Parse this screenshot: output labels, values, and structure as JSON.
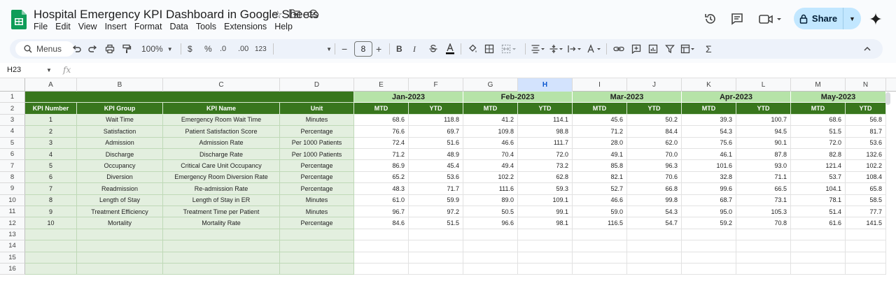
{
  "app": {
    "doc_title": "Hospital Emergency KPI Dashboard in Google Sheets",
    "menu": [
      "File",
      "Edit",
      "View",
      "Insert",
      "Format",
      "Data",
      "Tools",
      "Extensions",
      "Help"
    ],
    "share_label": "Share"
  },
  "toolbar": {
    "menus_label": "Menus",
    "zoom": "100%",
    "currency": "$",
    "percent": "%",
    "dec_decrease": ".0",
    "dec_increase": ".00",
    "number_format": "123",
    "font_size": "8",
    "minus": "−",
    "plus": "+",
    "bold": "B",
    "italic": "I"
  },
  "formula_bar": {
    "name_box": "H23",
    "fx": "fx"
  },
  "columns": [
    "A",
    "B",
    "C",
    "D",
    "E",
    "F",
    "G",
    "H",
    "I",
    "J",
    "K",
    "L",
    "M",
    "N"
  ],
  "selected_column": "H",
  "row_numbers": [
    "1",
    "2",
    "3",
    "4",
    "5",
    "6",
    "7",
    "8",
    "9",
    "10",
    "11",
    "12",
    "13",
    "14",
    "15",
    "16"
  ],
  "sheet": {
    "headers": [
      "KPI Number",
      "KPI Group",
      "KPI Name",
      "Unit"
    ],
    "months": [
      "Jan-2023",
      "Feb-2023",
      "Mar-2023",
      "Apr-2023",
      "May-2023"
    ],
    "mtd_label": "MTD",
    "ytd_label": "YTD",
    "rows": [
      {
        "num": "1",
        "group": "Wait Time",
        "name": "Emergency Room Wait Time",
        "unit": "Minutes",
        "values": [
          "68.6",
          "118.8",
          "41.2",
          "114.1",
          "45.6",
          "50.2",
          "39.3",
          "100.7",
          "68.6",
          "56.8"
        ]
      },
      {
        "num": "2",
        "group": "Satisfaction",
        "name": "Patient Satisfaction Score",
        "unit": "Percentage",
        "values": [
          "76.6",
          "69.7",
          "109.8",
          "98.8",
          "71.2",
          "84.4",
          "54.3",
          "94.5",
          "51.5",
          "81.7"
        ]
      },
      {
        "num": "3",
        "group": "Admission",
        "name": "Admission Rate",
        "unit": "Per 1000 Patients",
        "values": [
          "72.4",
          "51.6",
          "46.6",
          "111.7",
          "28.0",
          "62.0",
          "75.6",
          "90.1",
          "72.0",
          "53.6"
        ]
      },
      {
        "num": "4",
        "group": "Discharge",
        "name": "Discharge Rate",
        "unit": "Per 1000 Patients",
        "values": [
          "71.2",
          "48.9",
          "70.4",
          "72.0",
          "49.1",
          "70.0",
          "46.1",
          "87.8",
          "82.8",
          "132.6"
        ]
      },
      {
        "num": "5",
        "group": "Occupancy",
        "name": "Critical Care Unit Occupancy",
        "unit": "Percentage",
        "values": [
          "86.9",
          "45.4",
          "49.4",
          "73.2",
          "85.8",
          "96.3",
          "101.6",
          "93.0",
          "121.4",
          "102.2"
        ]
      },
      {
        "num": "6",
        "group": "Diversion",
        "name": "Emergency Room Diversion Rate",
        "unit": "Percentage",
        "values": [
          "65.2",
          "53.6",
          "102.2",
          "62.8",
          "82.1",
          "70.6",
          "32.8",
          "71.1",
          "53.7",
          "108.4"
        ]
      },
      {
        "num": "7",
        "group": "Readmission",
        "name": "Re-admission Rate",
        "unit": "Percentage",
        "values": [
          "48.3",
          "71.7",
          "111.6",
          "59.3",
          "52.7",
          "66.8",
          "99.6",
          "66.5",
          "104.1",
          "65.8"
        ]
      },
      {
        "num": "8",
        "group": "Length of Stay",
        "name": "Length of Stay in ER",
        "unit": "Minutes",
        "values": [
          "61.0",
          "59.9",
          "89.0",
          "109.1",
          "46.6",
          "99.8",
          "68.7",
          "73.1",
          "78.1",
          "58.5"
        ]
      },
      {
        "num": "9",
        "group": "Treatment Efficiency",
        "name": "Treatment Time per Patient",
        "unit": "Minutes",
        "values": [
          "96.7",
          "97.2",
          "50.5",
          "99.1",
          "59.0",
          "54.3",
          "95.0",
          "105.3",
          "51.4",
          "77.7"
        ]
      },
      {
        "num": "10",
        "group": "Mortality",
        "name": "Mortality Rate",
        "unit": "Percentage",
        "values": [
          "84.6",
          "51.5",
          "96.6",
          "98.1",
          "116.5",
          "54.7",
          "59.2",
          "70.8",
          "61.6",
          "141.5"
        ]
      }
    ]
  },
  "colors": {
    "header_green": "#38761d",
    "month_green": "#b6e3a8",
    "left_fill": "#e3efdf",
    "share_bg": "#c2e7ff"
  }
}
